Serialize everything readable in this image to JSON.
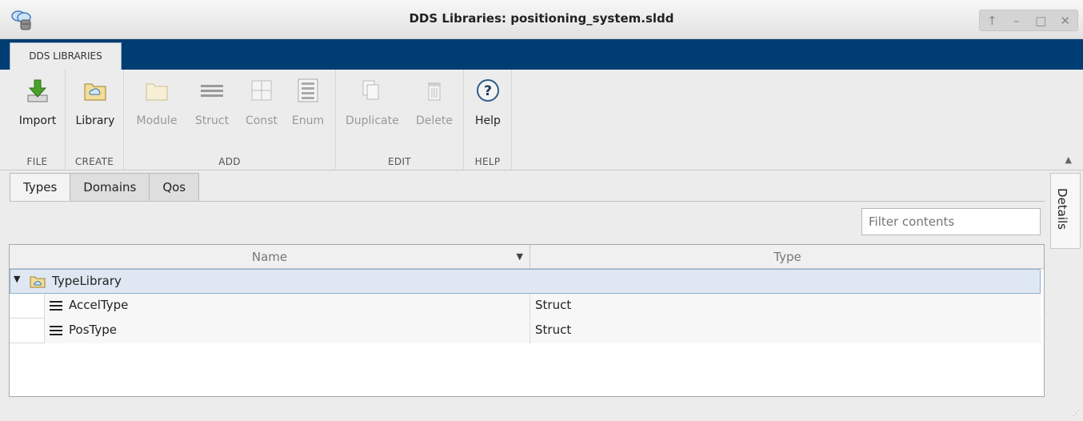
{
  "window": {
    "title": "DDS Libraries: positioning_system.sldd",
    "controls": [
      "↑",
      "–",
      "□",
      "✕"
    ]
  },
  "ribbon": {
    "tab_label": "DDS LIBRARIES"
  },
  "toolstrip": {
    "groups": {
      "file": "FILE",
      "create": "CREATE",
      "add": "ADD",
      "edit": "EDIT",
      "help": "HELP"
    },
    "buttons": {
      "import": "Import",
      "library": "Library",
      "module": "Module",
      "struct": "Struct",
      "const": "Const",
      "enum": "Enum",
      "duplicate": "Duplicate",
      "delete": "Delete",
      "help": "Help"
    }
  },
  "tabs": [
    "Types",
    "Domains",
    "Qos"
  ],
  "filter": {
    "placeholder": "Filter contents"
  },
  "details": {
    "label": "Details"
  },
  "table": {
    "columns": {
      "name": "Name",
      "type": "Type"
    },
    "library": {
      "name": "TypeLibrary"
    },
    "rows": [
      {
        "name": "AccelType",
        "type": "Struct"
      },
      {
        "name": "PosType",
        "type": "Struct"
      }
    ]
  },
  "colors": {
    "ribbon": "#003d73",
    "selection": "#dfe8f2",
    "import_green": "#4aa02c"
  }
}
